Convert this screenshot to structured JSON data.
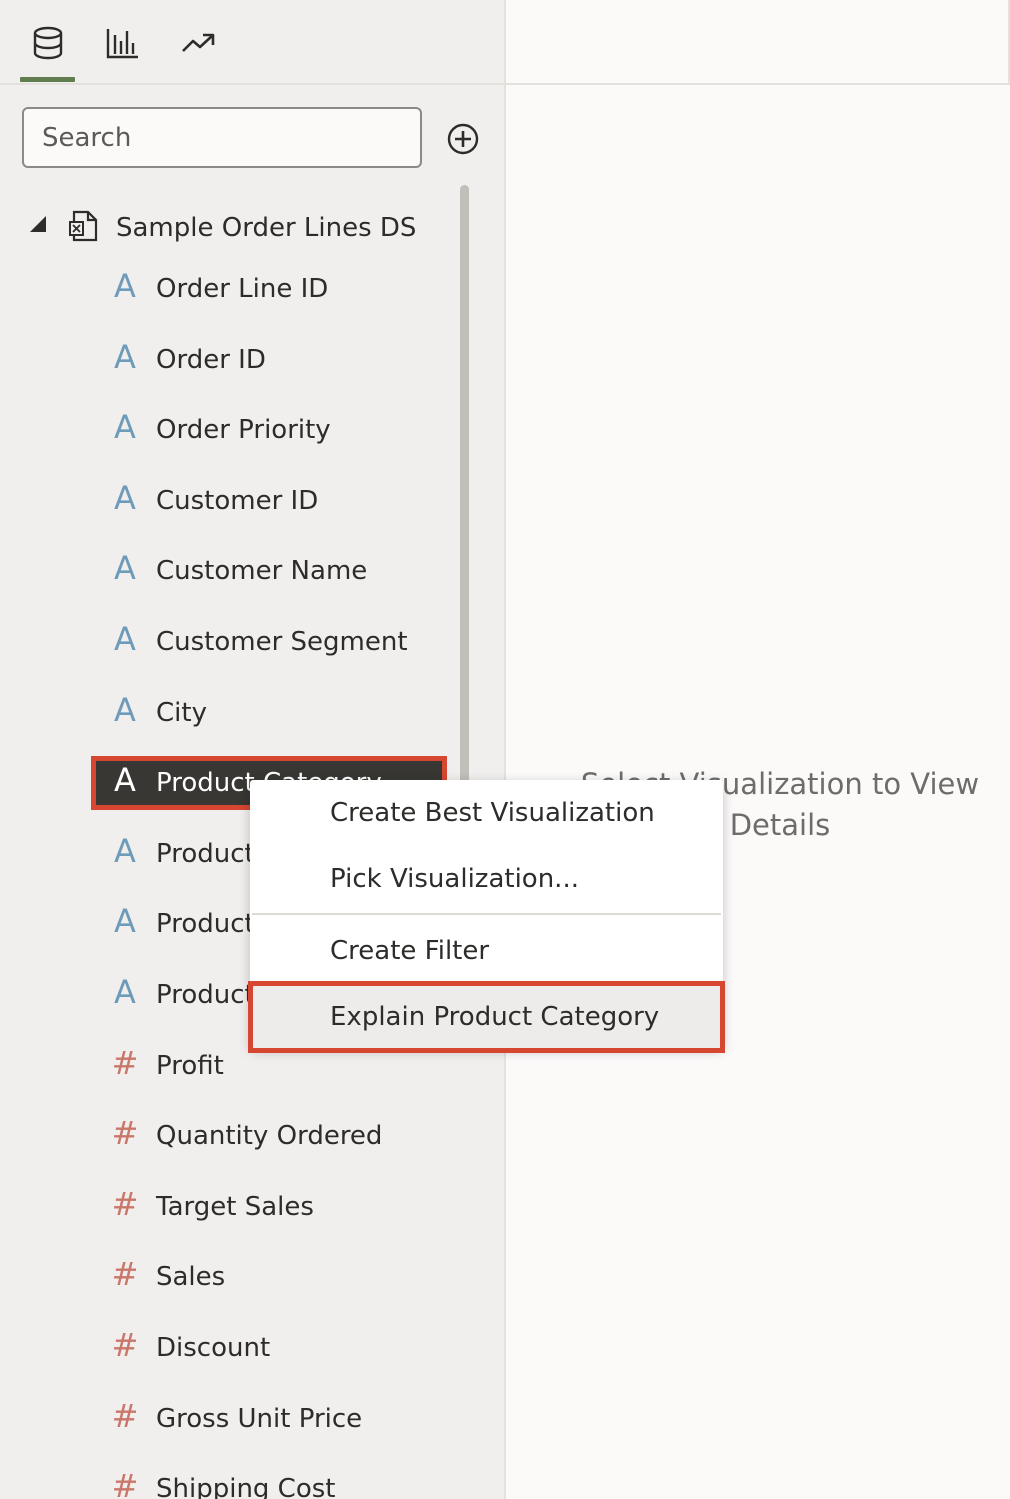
{
  "tabs": [
    {
      "name": "data-tab",
      "icon": "database-icon",
      "active": true
    },
    {
      "name": "visualizations-tab",
      "icon": "bar-chart-icon",
      "active": false
    },
    {
      "name": "analytics-tab",
      "icon": "trend-line-icon",
      "active": false
    }
  ],
  "search": {
    "placeholder": "Search",
    "value": ""
  },
  "add_icon": "plus-circle-icon",
  "tree": {
    "root_label": "Sample Order Lines DS",
    "fields": [
      {
        "label": "Order Line ID",
        "type": "attribute",
        "icon": "A"
      },
      {
        "label": "Order ID",
        "type": "attribute",
        "icon": "A"
      },
      {
        "label": "Order Priority",
        "type": "attribute",
        "icon": "A"
      },
      {
        "label": "Customer ID",
        "type": "attribute",
        "icon": "A"
      },
      {
        "label": "Customer Name",
        "type": "attribute",
        "icon": "A"
      },
      {
        "label": "Customer Segment",
        "type": "attribute",
        "icon": "A"
      },
      {
        "label": "City",
        "type": "attribute",
        "icon": "A"
      },
      {
        "label": "Product Category",
        "type": "attribute",
        "icon": "A",
        "selected": true
      },
      {
        "label": "Product",
        "type": "attribute",
        "icon": "A"
      },
      {
        "label": "Product",
        "type": "attribute",
        "icon": "A"
      },
      {
        "label": "Product",
        "type": "attribute",
        "icon": "A"
      },
      {
        "label": "Profit",
        "type": "measure",
        "icon": "#"
      },
      {
        "label": "Quantity Ordered",
        "type": "measure",
        "icon": "#"
      },
      {
        "label": "Target Sales",
        "type": "measure",
        "icon": "#"
      },
      {
        "label": "Sales",
        "type": "measure",
        "icon": "#"
      },
      {
        "label": "Discount",
        "type": "measure",
        "icon": "#"
      },
      {
        "label": "Gross Unit Price",
        "type": "measure",
        "icon": "#"
      },
      {
        "label": "Shipping Cost",
        "type": "measure",
        "icon": "#"
      }
    ]
  },
  "context_menu": {
    "items": [
      {
        "label": "Create Best Visualization"
      },
      {
        "label": "Pick Visualization..."
      },
      {
        "label": "Create Filter"
      },
      {
        "label": "Explain Product Category",
        "highlighted": true
      }
    ]
  },
  "canvas": {
    "hint": "Select Visualization to View Details"
  },
  "colors": {
    "attribute_icon": "#6f9bbb",
    "measure_icon": "#c9776a",
    "highlight_border": "#d64631",
    "active_tab": "#5f7d4f",
    "selected_row_bg": "#393734"
  }
}
